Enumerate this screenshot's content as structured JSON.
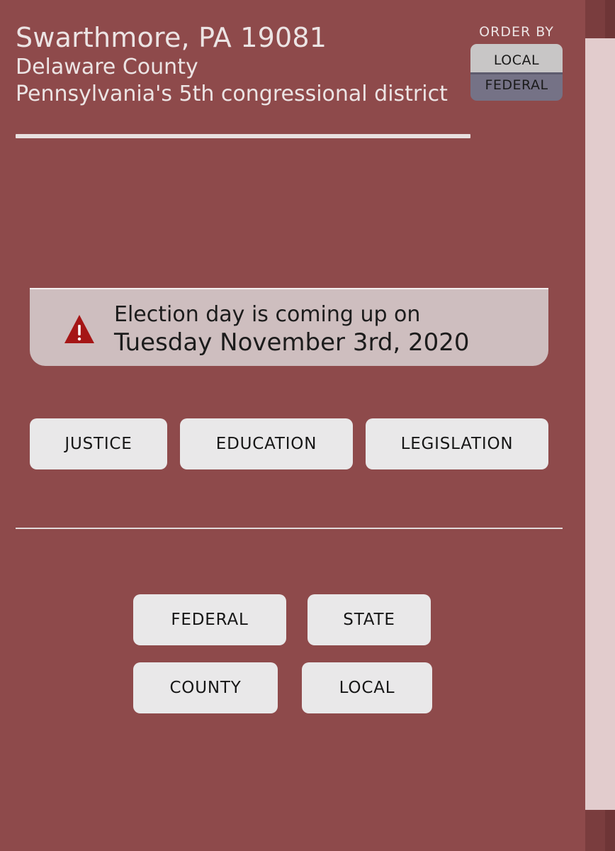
{
  "header": {
    "title": "Swarthmore, PA 19081",
    "county": "Delaware County",
    "district": "Pennsylvania's 5th congressional district"
  },
  "order_by": {
    "label": "ORDER BY",
    "options": [
      "LOCAL",
      "FEDERAL"
    ],
    "selected": "FEDERAL"
  },
  "alert": {
    "icon": "warning-icon",
    "line1": "Election day is coming up on",
    "line2": "Tuesday November 3rd, 2020"
  },
  "topics": [
    "JUSTICE",
    "EDUCATION",
    "LEGISLATION"
  ],
  "levels": [
    "FEDERAL",
    "STATE",
    "COUNTY",
    "LOCAL"
  ],
  "colors": {
    "background": "#8e4a4b",
    "alert_bg": "#cebebf",
    "button_bg": "#e9e8e9",
    "warning": "#a51616",
    "selected_option": "#757286"
  }
}
